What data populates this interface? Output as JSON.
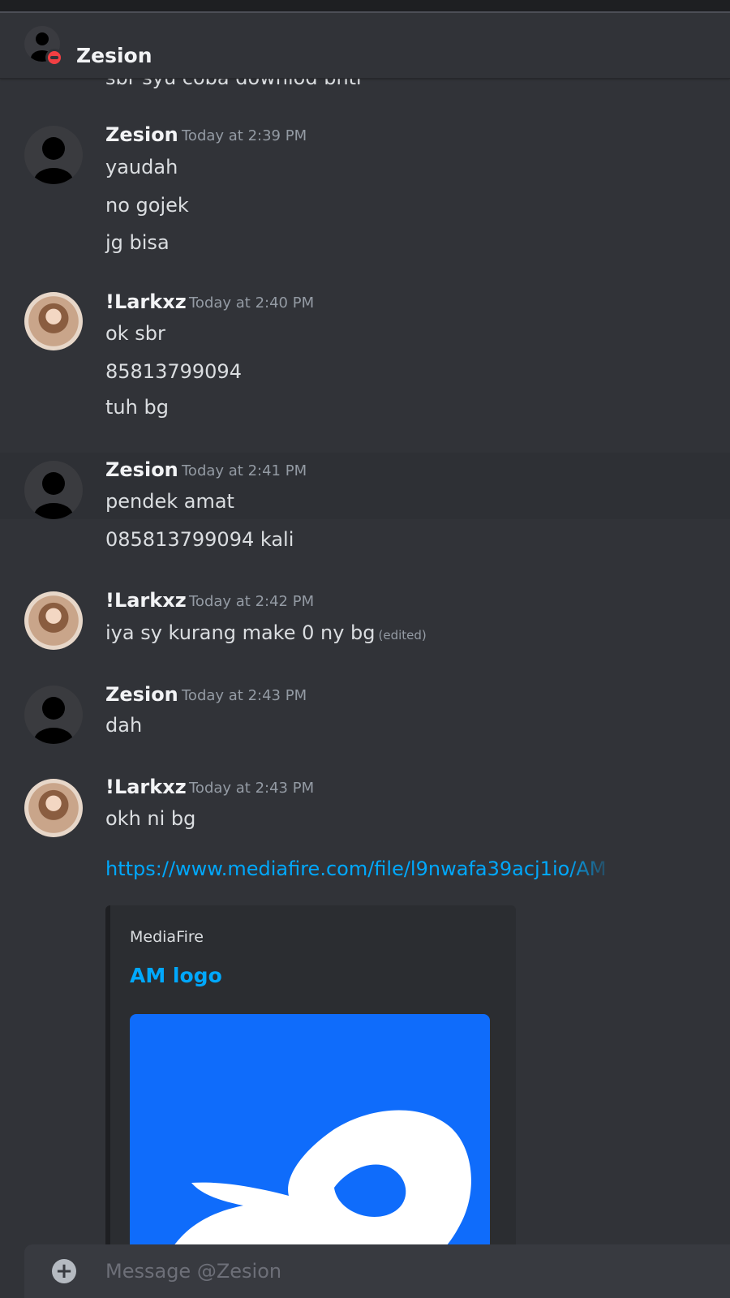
{
  "header": {
    "title": "Zesion"
  },
  "clipped_previous": "sbr syu coba downlod bntr",
  "messages": [
    {
      "author": "Zesion",
      "time": "Today at 2:39 PM",
      "lines": [
        "yaudah",
        "no gojek",
        "jg bisa"
      ]
    },
    {
      "author": "!Larkxz",
      "time": "Today at 2:40 PM",
      "lines": [
        "ok sbr",
        "85813799094",
        "tuh bg"
      ]
    },
    {
      "author": "Zesion",
      "time": "Today at 2:41 PM",
      "lines": [
        "pendek amat",
        "085813799094 kali"
      ]
    },
    {
      "author": "!Larkxz",
      "time": "Today at 2:42 PM",
      "lines": [
        "iya sy kurang make 0 ny bg"
      ],
      "edited": "(edited)"
    },
    {
      "author": "Zesion",
      "time": "Today at 2:43 PM",
      "lines": [
        "dah"
      ]
    },
    {
      "author": "!Larkxz",
      "time": "Today at 2:43 PM",
      "lines": [
        "okh ni bg"
      ],
      "link": "https://www.mediafire.com/file/l9nwafa39acj1io/AM"
    }
  ],
  "embed": {
    "provider": "MediaFire",
    "title": "AM logo"
  },
  "composer": {
    "placeholder": "Message @Zesion"
  },
  "colors": {
    "background": "#313338",
    "link": "#00a8fc",
    "embed_image": "#0f6cfb",
    "dnd_status": "#f23f43"
  }
}
